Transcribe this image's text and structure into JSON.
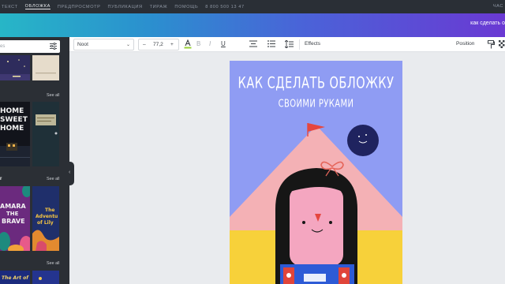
{
  "topnav": {
    "items": [
      "ТЕКСТ",
      "ОБЛОЖКА",
      "ПРЕДПРОСМОТР",
      "ПУБЛИКАЦИЯ",
      "ТИРАЖ",
      "ПОМОЩЬ"
    ],
    "active_index": 1,
    "phone": "8 800 500 13 47",
    "right_text": "ЧАС"
  },
  "header": {
    "share_link": "как сделать о"
  },
  "sidebar": {
    "search_placeholder": "es",
    "sections": [
      {
        "title": "",
        "see_all": "See all"
      },
      {
        "title": "r",
        "see_all": "See all"
      },
      {
        "title": "",
        "see_all": "See all"
      }
    ],
    "thumbs": {
      "home_lines": [
        "HOME",
        "SWEET",
        "HOME"
      ],
      "amara_lines": [
        "AMARA",
        "THE",
        "BRAVE"
      ],
      "adventure_lines": [
        "The",
        "Adventu",
        "of Lily"
      ],
      "bottom_text": "The Art of"
    }
  },
  "toolbar": {
    "font_name": "Noot",
    "font_size": "77,2",
    "minus": "–",
    "plus": "+",
    "bold": "B",
    "italic": "I",
    "underline": "U",
    "effects": "Effects",
    "position": "Position"
  },
  "design": {
    "title": "КАК СДЕЛАТЬ ОБЛОЖКУ",
    "subtitle": "СВОИМИ РУКАМИ",
    "colors": {
      "background": "#8f9cf3",
      "mountain": "#f4b1b5",
      "ground": "#f7d13a",
      "flag": "#e5463f",
      "moon": "#1f235f",
      "hair": "#161616",
      "face": "#f4a6c0",
      "shirt": "#2d5bd6",
      "overalls": "#e0453a"
    }
  },
  "colors": {
    "topnav_bg": "#2a2f36",
    "panel_bg": "#2b2f35",
    "gradient_start": "#27b6c7",
    "gradient_end": "#6a39d3",
    "workspace_bg": "#e9ebee"
  }
}
